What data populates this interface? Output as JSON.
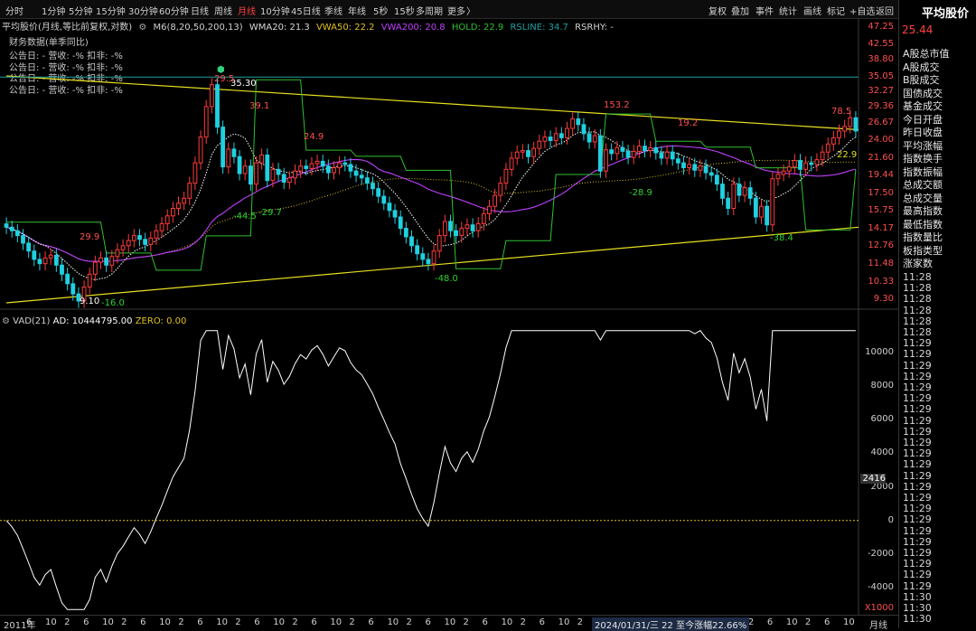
{
  "tabs": [
    "分时",
    "1分钟",
    "5分钟",
    "15分钟",
    "30分钟",
    "60分钟",
    "日线",
    "周线",
    "月线",
    "10分钟",
    "45日线",
    "季线",
    "年线",
    "5秒",
    "15秒",
    "多周期",
    "更多"
  ],
  "active_tab": "月线",
  "right_buttons": [
    "复权",
    "叠加",
    "事件",
    "统计",
    "画线",
    "标记",
    "+自选",
    "返回"
  ],
  "legend_main": {
    "title": "平均股价(月线,等比前复权,对数)",
    "m6": "M6(8,20,50,200,13)",
    "wma20": "WMA20: 21.3",
    "vwa50": "VWA50: 22.2",
    "vwa200": "VWA200: 20.8",
    "hold": "HOLD: 22.9",
    "rsline": "RSLINE: 34.7",
    "rsrhy": "RSRHY: -"
  },
  "legend_colors": {
    "wma20": "#d8d8d8",
    "vwa50": "#e0c020",
    "vwa200": "#c040ff",
    "hold": "#30c030",
    "rsline": "#20a0a0"
  },
  "finance": {
    "header": "财务数据(单季同比)",
    "rows": [
      "公告日: -   营收: -%   扣非: -%",
      "公告日: -   营收: -%   扣非: -%",
      "公告日: -   营收: -%   扣非: -%",
      "公告日: -   营收: -%   扣非: -%"
    ]
  },
  "annotations": [
    {
      "text": "9.10",
      "color": "#ffffff"
    },
    {
      "text": "-16.0",
      "color": "#30d030"
    },
    {
      "text": "29.9",
      "color": "#ff5050"
    },
    {
      "text": "35.30",
      "color": "#ffffff"
    },
    {
      "text": "29.5",
      "color": "#ff5050"
    },
    {
      "text": "39.1",
      "color": "#ff5050"
    },
    {
      "text": "-44.5",
      "color": "#30d030"
    },
    {
      "text": "-29.7",
      "color": "#30d030"
    },
    {
      "text": "24.9",
      "color": "#ff5050"
    },
    {
      "text": "-48.0",
      "color": "#30d030"
    },
    {
      "text": "153.2",
      "color": "#ff5050"
    },
    {
      "text": "19.2",
      "color": "#ff5050"
    },
    {
      "text": "-28.9",
      "color": "#30d030"
    },
    {
      "text": "-38.4",
      "color": "#30d030"
    },
    {
      "text": "78.5",
      "color": "#ff5050"
    },
    {
      "text": "22.9",
      "color": "#e0e020"
    }
  ],
  "price_axis": [
    "47.25",
    "42.55",
    "38.80",
    "35.05",
    "32.27",
    "29.36",
    "26.67",
    "24.00",
    "21.60",
    "19.44",
    "17.50",
    "15.75",
    "14.17",
    "12.76",
    "11.48",
    "10.33",
    "9.30"
  ],
  "vad_legend": {
    "title": "VAD(21)",
    "ad": "AD: 10444795.00",
    "zero": "ZERO: 0.00"
  },
  "vad_axis": [
    "10000",
    "8000",
    "6000",
    "4000",
    "2000",
    "0",
    "-2000",
    "-4000"
  ],
  "vad_current": "2416",
  "vad_unit": "X1000",
  "x_axis": [
    "2011年",
    "6",
    "10",
    "2",
    "6",
    "10",
    "2",
    "6",
    "10",
    "2",
    "6",
    "10",
    "2",
    "6",
    "10",
    "2",
    "6",
    "10",
    "2",
    "6",
    "10",
    "2",
    "6",
    "10",
    "2",
    "6",
    "10",
    "2",
    "6",
    "10",
    "2",
    "6",
    "10",
    "2",
    "6",
    "10",
    "2",
    "6",
    "10",
    "2",
    "6",
    "10",
    "2",
    "6",
    "10"
  ],
  "x_axis_unit": "月线",
  "x_tooltip": "2024/01/31/三 22 至今涨幅22.66%",
  "right_panel": {
    "title": "平均股价",
    "price": "25.44",
    "items": [
      "A股总市值",
      "A股成交",
      "B股成交",
      "国债成交",
      "基金成交",
      "今日开盘",
      "昨日收盘",
      "平均涨幅",
      "指数换手",
      "指数振幅",
      "总成交额",
      "总成交量",
      "最高指数",
      "最低指数",
      "指数量比",
      "板指类型",
      "涨家数"
    ],
    "times": [
      "11:28",
      "11:28",
      "11:28",
      "11:28",
      "11:28",
      "11:28",
      "11:29",
      "11:29",
      "11:29",
      "11:29",
      "11:29",
      "11:29",
      "11:29",
      "11:29",
      "11:29",
      "11:29",
      "11:29",
      "11:29",
      "11:29",
      "11:29",
      "11:29",
      "11:29",
      "11:29",
      "11:29",
      "11:29",
      "11:29",
      "11:29",
      "11:29",
      "11:29",
      "11:30",
      "11:30",
      "11:30"
    ]
  },
  "chart_data": [
    {
      "type": "candlestick",
      "title": "平均股价(月线,等比前复权,对数)",
      "scale": "log",
      "ylim": [
        9.1,
        47.25
      ],
      "n_months": 160,
      "resistance_line": {
        "from": [
          0,
          35.3
        ],
        "to": [
          159,
          25.6
        ]
      },
      "support_line": {
        "from": [
          0,
          9.1
        ],
        "to": [
          159,
          14.3
        ]
      },
      "hline": 35.05,
      "closes": [
        14.3,
        14.0,
        13.6,
        13.0,
        12.4,
        11.8,
        11.5,
        11.9,
        12.1,
        11.4,
        10.8,
        10.2,
        9.6,
        9.2,
        10.0,
        10.8,
        11.6,
        11.9,
        11.4,
        12.0,
        12.5,
        12.8,
        13.2,
        13.6,
        13.3,
        12.9,
        13.4,
        14.0,
        14.6,
        15.3,
        16.0,
        16.5,
        17.0,
        18.6,
        21.0,
        24.5,
        29.4,
        33.5,
        26.0,
        20.5,
        22.8,
        21.8,
        19.7,
        20.6,
        18.5,
        21.0,
        22.0,
        18.9,
        20.2,
        19.6,
        18.7,
        19.2,
        20.0,
        20.6,
        20.3,
        20.9,
        21.2,
        20.6,
        19.8,
        20.4,
        21.0,
        20.8,
        20.0,
        19.5,
        19.2,
        18.6,
        18.0,
        17.2,
        16.5,
        15.8,
        15.2,
        14.2,
        13.5,
        12.8,
        12.2,
        11.8,
        11.5,
        12.4,
        13.6,
        14.8,
        14.0,
        13.6,
        14.2,
        14.5,
        14.0,
        14.6,
        15.5,
        16.2,
        17.3,
        18.6,
        20.2,
        21.6,
        22.4,
        22.6,
        21.8,
        22.9,
        23.9,
        24.5,
        24.0,
        25.0,
        24.4,
        25.8,
        27.3,
        26.4,
        25.0,
        23.8,
        24.7,
        20.0,
        22.7,
        22.2,
        23.0,
        22.5,
        21.7,
        22.5,
        23.2,
        22.6,
        23.0,
        22.3,
        21.6,
        22.4,
        21.5,
        21.0,
        20.4,
        20.8,
        20.1,
        20.6,
        19.8,
        19.5,
        18.5,
        17.0,
        16.0,
        18.5,
        17.3,
        18.1,
        17.0,
        15.2,
        16.2,
        14.5,
        19.1,
        19.6,
        20.0,
        20.5,
        21.3,
        20.2,
        21.0,
        20.8,
        21.4,
        22.4,
        23.5,
        24.4,
        25.4,
        26.1,
        27.5,
        25.4
      ],
      "vad": {
        "ylim": [
          -5500,
          11500
        ],
        "current": 2416,
        "unit": "X1000"
      }
    }
  ]
}
